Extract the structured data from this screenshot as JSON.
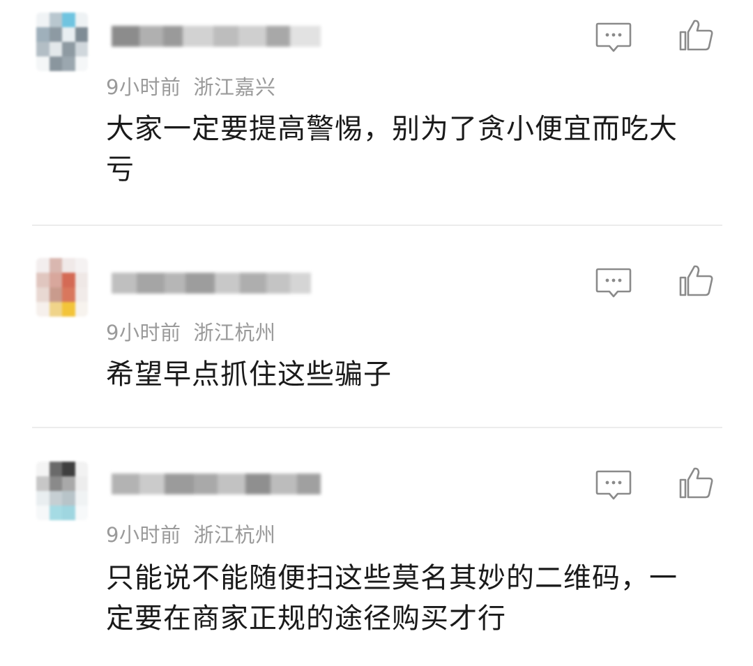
{
  "comments": [
    {
      "time": "9小时前",
      "location": "浙江嘉兴",
      "text": "大家一定要提高警惕，别为了贪小便宜而吃大亏"
    },
    {
      "time": "9小时前",
      "location": "浙江杭州",
      "text": "希望早点抓住这些骗子"
    },
    {
      "time": "9小时前",
      "location": "浙江杭州",
      "text": "只能说不能随便扫这些莫名其妙的二维码，一定要在商家正规的途径购买才行"
    }
  ],
  "icons": {
    "reply": "comment-bubble-icon",
    "like": "thumbs-up-icon"
  },
  "colors": {
    "meta_text": "#9a9a9a",
    "body_text": "#1a1a1a",
    "icon_stroke": "#8a8a8a",
    "divider": "#ececec"
  }
}
